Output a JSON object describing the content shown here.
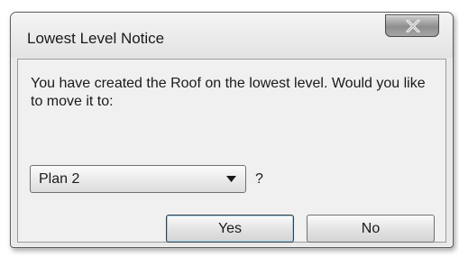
{
  "dialog": {
    "title": "Lowest Level Notice",
    "close_icon": "close-x-icon",
    "message": "You have created the Roof on the lowest level.  Would you like to move it to:",
    "level_select": {
      "selected": "Plan 2"
    },
    "question_mark": "?",
    "yes_label": "Yes",
    "no_label": "No"
  }
}
